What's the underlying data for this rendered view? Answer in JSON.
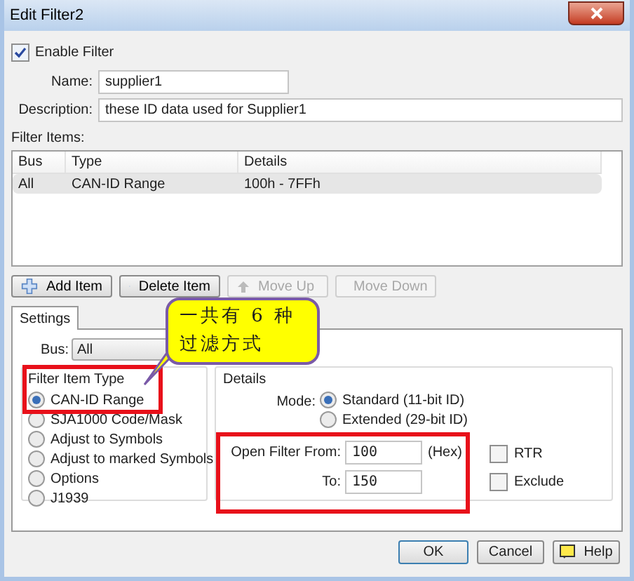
{
  "window": {
    "title": "Edit Filter2"
  },
  "enable_filter": {
    "label": "Enable Filter",
    "checked": true
  },
  "name": {
    "label": "Name:",
    "value": "supplier1"
  },
  "description": {
    "label": "Description:",
    "value": "these ID data used for Supplier1"
  },
  "filter_items": {
    "label": "Filter Items:",
    "columns": [
      "Bus",
      "Type",
      "Details"
    ],
    "rows": [
      {
        "cells": [
          "All",
          "CAN-ID Range",
          "100h - 7FFh"
        ],
        "selected": true
      }
    ]
  },
  "item_buttons": [
    {
      "label": "Add Item",
      "kind": "add",
      "disabled": false
    },
    {
      "label": "Delete Item",
      "kind": "delete",
      "disabled": false
    },
    {
      "label": "Move Up",
      "kind": "up",
      "disabled": true
    },
    {
      "label": "Move Down",
      "kind": "down",
      "disabled": true
    }
  ],
  "tabs": [
    {
      "label": "Settings",
      "selected": true
    }
  ],
  "bus": {
    "label": "Bus:",
    "value": "All"
  },
  "filter_item_type": {
    "label": "Filter Item Type",
    "options": [
      {
        "label": "CAN-ID Range",
        "selected": true
      },
      {
        "label": "SJA1000 Code/Mask",
        "selected": false
      },
      {
        "label": "Adjust to Symbols",
        "selected": false
      },
      {
        "label": "Adjust to marked Symbols",
        "selected": false
      },
      {
        "label": "Options",
        "selected": false
      },
      {
        "label": "J1939",
        "selected": false
      }
    ]
  },
  "details": {
    "label": "Details",
    "mode_label": "Mode:",
    "modes": [
      {
        "label": "Standard (11-bit ID)",
        "selected": true
      },
      {
        "label": "Extended (29-bit ID)",
        "selected": false
      }
    ],
    "from": {
      "label": "Open Filter From:",
      "value": "100",
      "unit": "(Hex)"
    },
    "to": {
      "label": "To:",
      "value": "150"
    },
    "checkboxes": [
      {
        "label": "RTR",
        "checked": false
      },
      {
        "label": "Exclude",
        "checked": false
      }
    ]
  },
  "dialog_buttons": [
    {
      "label": "OK",
      "kind": "default"
    },
    {
      "label": "Cancel",
      "kind": "plain"
    },
    {
      "label": "Help",
      "kind": "help"
    }
  ],
  "callout": {
    "text": "一共有 6 种过滤方式"
  }
}
